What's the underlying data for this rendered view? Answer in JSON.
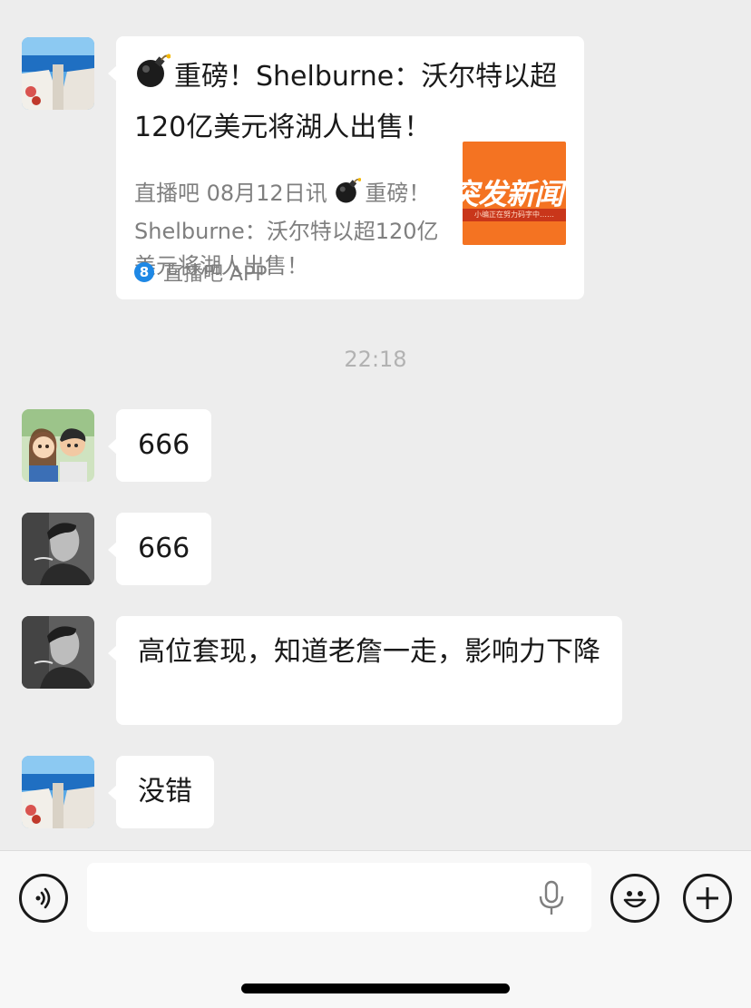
{
  "messages": {
    "link_card": {
      "title": "重磅！Shelburne：沃尔特以超120亿美元将湖人出售！",
      "desc_prefix": "直播吧 08月12日讯 ",
      "desc_suffix": "重磅！Shelburne：沃尔特以超120亿美元将湖人出售！",
      "thumbnail_text": "突发新闻",
      "thumbnail_subtext": "小编正在努力码字中……",
      "source_icon": "8",
      "source_name": "直播吧 APP",
      "title_icon": "bomb-icon"
    },
    "timestamp": "22:18",
    "msg1": "666",
    "msg2": "666",
    "msg3": "高位套现，知道老詹一走，影响力下降",
    "msg4": "没错"
  },
  "input_bar": {
    "voice_icon": "voice-icon",
    "mic_icon": "microphone-icon",
    "emoji_icon": "emoji-icon",
    "plus_icon": "plus-icon",
    "value": ""
  },
  "colors": {
    "background": "#ededed",
    "bubble": "#ffffff",
    "thumbnail": "#f47322",
    "source_icon": "#1e88e5"
  }
}
